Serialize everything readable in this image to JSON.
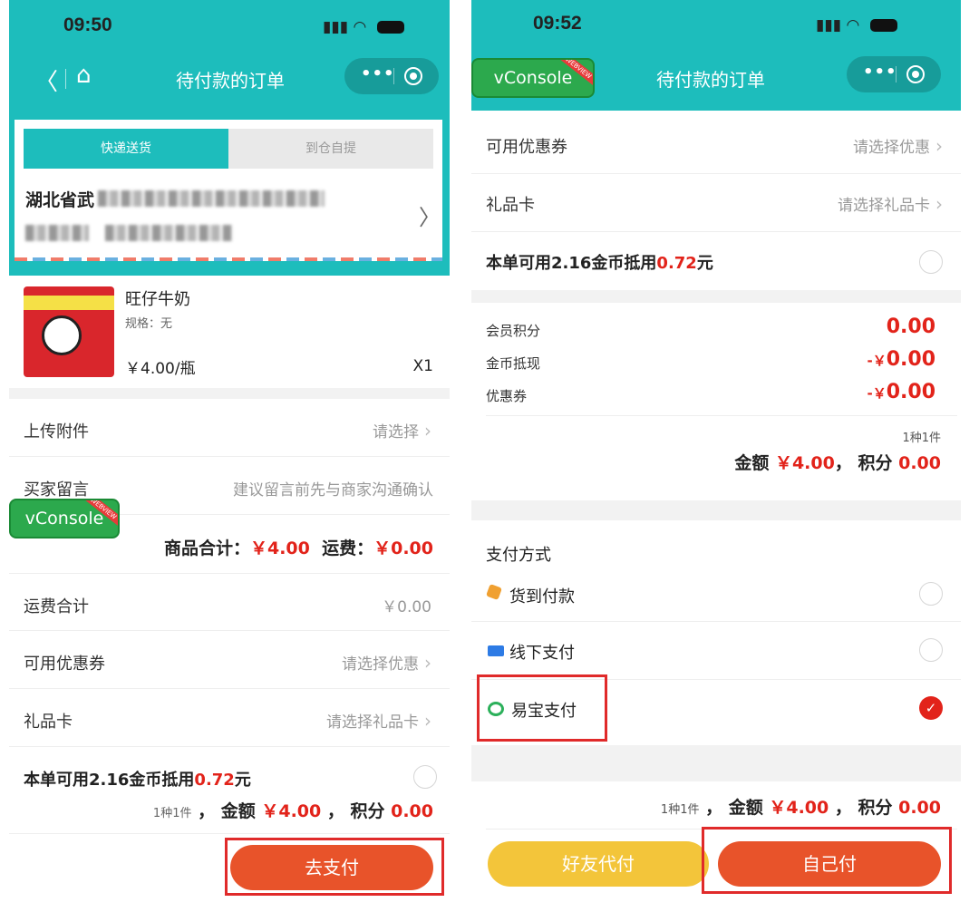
{
  "left": {
    "status_time": "09:50",
    "nav_title": "待付款的订单",
    "delivery_tabs": [
      "快递送货",
      "到仓自提"
    ],
    "address_line1": "湖北省武",
    "address_line2": "",
    "vconsole": "vConsole",
    "vconsole_ribbon": "WEBVIEW",
    "product": {
      "name": "旺仔牛奶",
      "spec": "规格：无",
      "price": "￥4.00/瓶",
      "qty": "X1"
    },
    "upload": {
      "label": "上传附件",
      "value": "请选择"
    },
    "message": {
      "label": "买家留言",
      "placeholder": "建议留言前先与商家沟通确认"
    },
    "goods_total_label": "商品合计：",
    "goods_total_value": "￥4.00",
    "freight_label": "运费：",
    "freight_value": "￥0.00",
    "freight_total": {
      "label": "运费合计",
      "value": "￥0.00"
    },
    "coupon": {
      "label": "可用优惠券",
      "value": "请选择优惠"
    },
    "giftcard": {
      "label": "礼品卡",
      "value": "请选择礼品卡"
    },
    "coins_text": "本单可用2.16金币抵用",
    "coins_amount": "0.72",
    "coins_unit": "元",
    "summary_count": "1种1件",
    "summary_amount_label": "金额",
    "summary_amount": "￥4.00",
    "summary_points_label": "积分",
    "summary_points": "0.00",
    "pay_button": "去支付"
  },
  "right": {
    "status_time": "09:52",
    "nav_title": "待付款的订单",
    "vconsole": "vConsole",
    "vconsole_ribbon": "WEBVIEW",
    "coupon": {
      "label": "可用优惠券",
      "value": "请选择优惠"
    },
    "giftcard": {
      "label": "礼品卡",
      "value": "请选择礼品卡"
    },
    "coins_text": "本单可用2.16金币抵用",
    "coins_amount": "0.72",
    "coins_unit": "元",
    "member_points_label": "会员积分",
    "member_points_value": "0.00",
    "coin_cash_label": "金币抵现",
    "coin_cash_prefix": "-￥",
    "coin_cash_value": "0.00",
    "coupon_deduct_label": "优惠券",
    "coupon_deduct_prefix": "-￥",
    "coupon_deduct_value": "0.00",
    "count": "1种1件",
    "amount_label": "金额",
    "amount_value": "￥4.00",
    "points_label": "积分",
    "points_value": "0.00",
    "pay_method_title": "支付方式",
    "pay_methods": [
      "货到付款",
      "线下支付",
      "易宝支付"
    ],
    "friend_pay": "好友代付",
    "self_pay": "自己付"
  },
  "colors": {
    "teal": "#1dbdbc",
    "price_red": "#e2231a",
    "orange_button": "#e8532a",
    "yellow_button": "#f3c53a",
    "vconsole_green": "#2ca94d"
  }
}
